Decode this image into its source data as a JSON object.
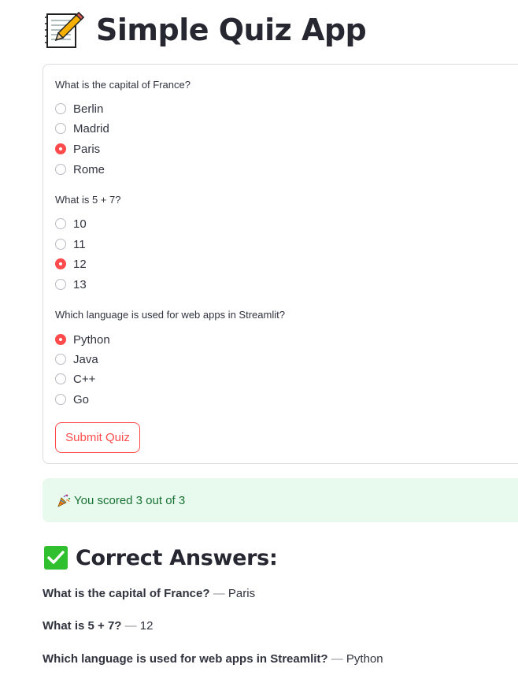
{
  "app": {
    "title": "Simple Quiz App",
    "title_icon": "memo-icon"
  },
  "questions": [
    {
      "text": "What is the capital of France?",
      "options": [
        "Berlin",
        "Madrid",
        "Paris",
        "Rome"
      ],
      "selected": 2
    },
    {
      "text": "What is 5 + 7?",
      "options": [
        "10",
        "11",
        "12",
        "13"
      ],
      "selected": 2
    },
    {
      "text": "Which language is used for web apps in Streamlit?",
      "options": [
        "Python",
        "Java",
        "C++",
        "Go"
      ],
      "selected": 0
    }
  ],
  "submit": {
    "label": "Submit Quiz"
  },
  "result": {
    "icon": "party-popper-icon",
    "text": "You scored 3 out of 3"
  },
  "answers": {
    "heading_icon": "check-mark-icon",
    "heading": "Correct Answers:",
    "separator": "—",
    "items": [
      {
        "question": "What is the capital of France?",
        "answer": "Paris"
      },
      {
        "question": "What is 5 + 7?",
        "answer": "12"
      },
      {
        "question": "Which language is used for web apps in Streamlit?",
        "answer": "Python"
      }
    ]
  },
  "colors": {
    "accent": "#ff4b4b",
    "success_bg": "#e8f9ee",
    "success_text": "#177233",
    "check_green": "#2fbf2f"
  }
}
